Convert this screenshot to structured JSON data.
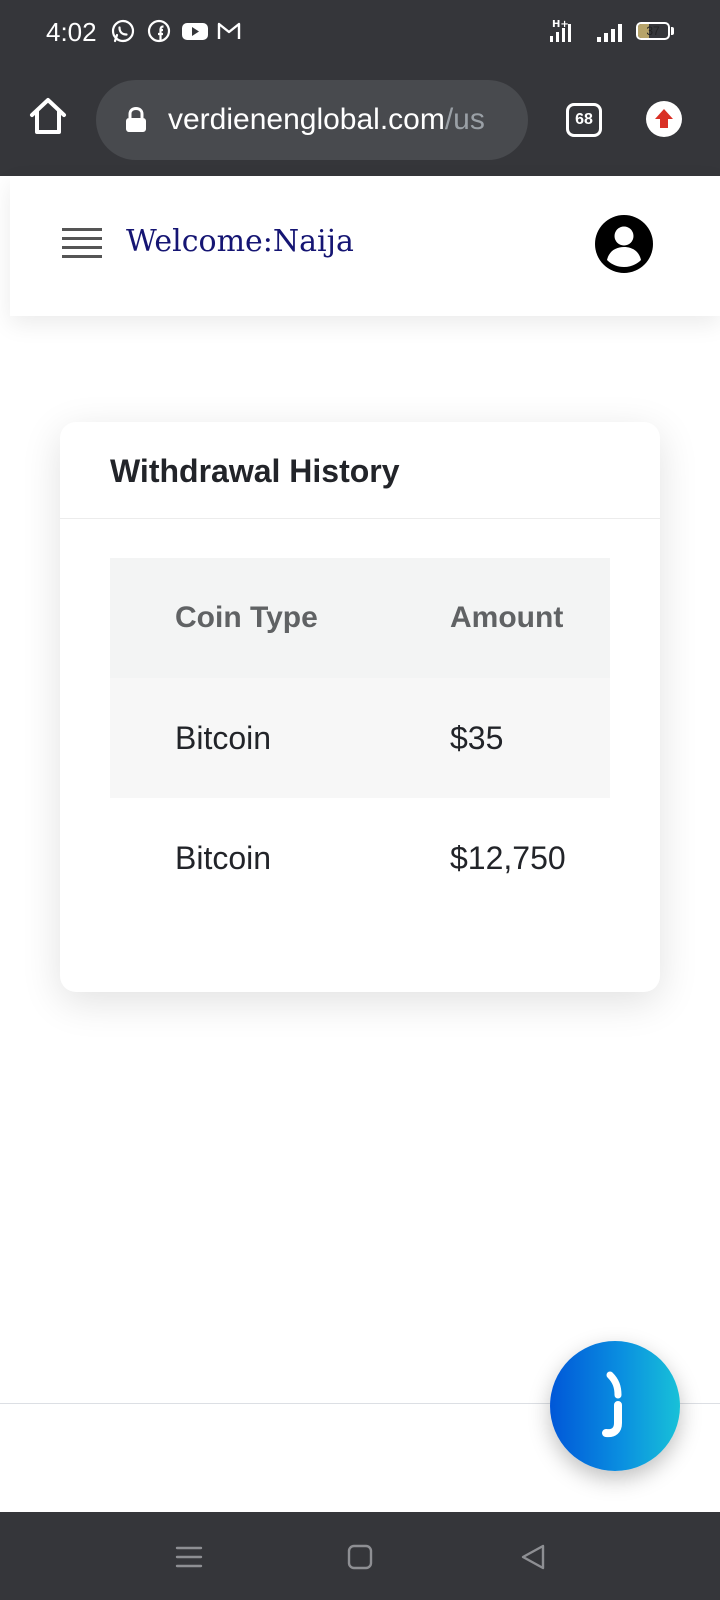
{
  "status_bar": {
    "time": "4:02",
    "notification_icons": [
      "whatsapp-icon",
      "facebook-icon",
      "youtube-icon",
      "gmail-icon"
    ],
    "network_label": "H+",
    "battery_level": "37"
  },
  "browser": {
    "url_domain": "verdienenglobal.com",
    "url_path": "/us",
    "tab_count": "68",
    "accent_color": "#d93025"
  },
  "header": {
    "welcome": "Welcome:Naija",
    "title_color": "#151573"
  },
  "card": {
    "title": "Withdrawal History",
    "columns": [
      "Coin Type",
      "Amount"
    ],
    "rows": [
      {
        "coin": "Bitcoin",
        "amount": "$35"
      },
      {
        "coin": "Bitcoin",
        "amount": "$12,750"
      }
    ]
  },
  "chat_widget": {
    "icon": "chat-bubble-icon",
    "colors": [
      "#0057d8",
      "#18c1d8"
    ]
  },
  "system_nav": {
    "buttons": [
      "recents-icon",
      "home-icon",
      "back-icon"
    ]
  }
}
